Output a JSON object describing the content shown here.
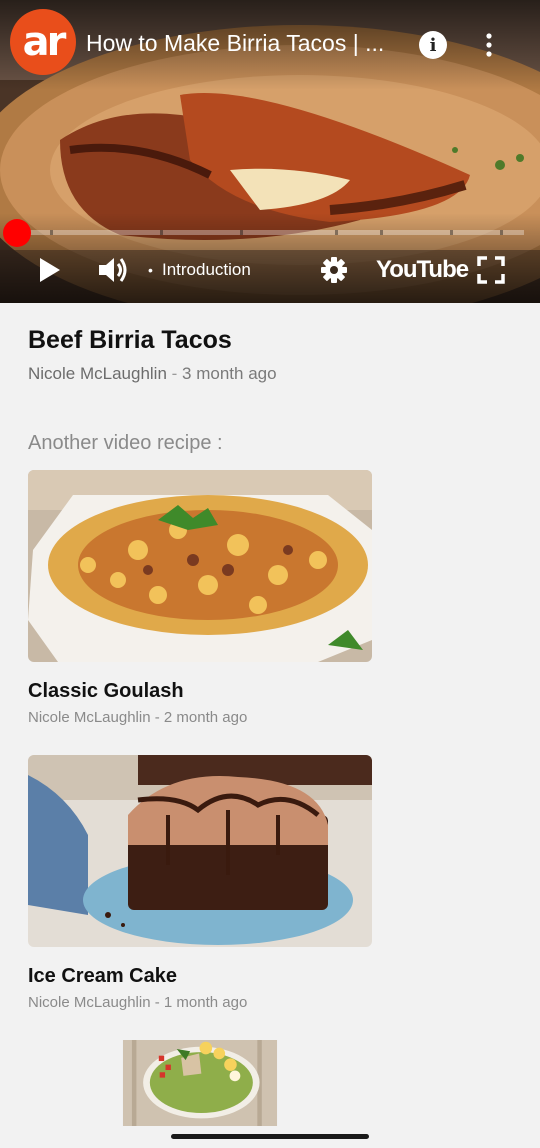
{
  "player": {
    "channel_logo_text": "ar",
    "title": "How to Make Birria Tacos | ...",
    "info_label": "i",
    "chapter_label": "Introduction",
    "chapter_separator": "•",
    "brand_label": "YouTube",
    "progress_fraction": 0.01,
    "accent_color": "#ff0000",
    "logo_color": "#e94e1b",
    "icons": [
      "play-icon",
      "volume-icon",
      "gear-icon",
      "fullscreen-icon",
      "more-vertical-icon",
      "info-icon"
    ]
  },
  "recipe": {
    "title": "Beef Birria Tacos",
    "author": "Nicole McLaughlin",
    "separator": "-",
    "age": "3 month ago"
  },
  "section_label": "Another video recipe :",
  "videos": [
    {
      "title": "Classic Goulash",
      "author": "Nicole McLaughlin",
      "separator": "-",
      "age": "2 month ago"
    },
    {
      "title": "Ice Cream Cake",
      "author": "Nicole McLaughlin",
      "separator": "-",
      "age": "1 month ago"
    },
    {
      "title": "",
      "author": "",
      "separator": "",
      "age": ""
    }
  ]
}
